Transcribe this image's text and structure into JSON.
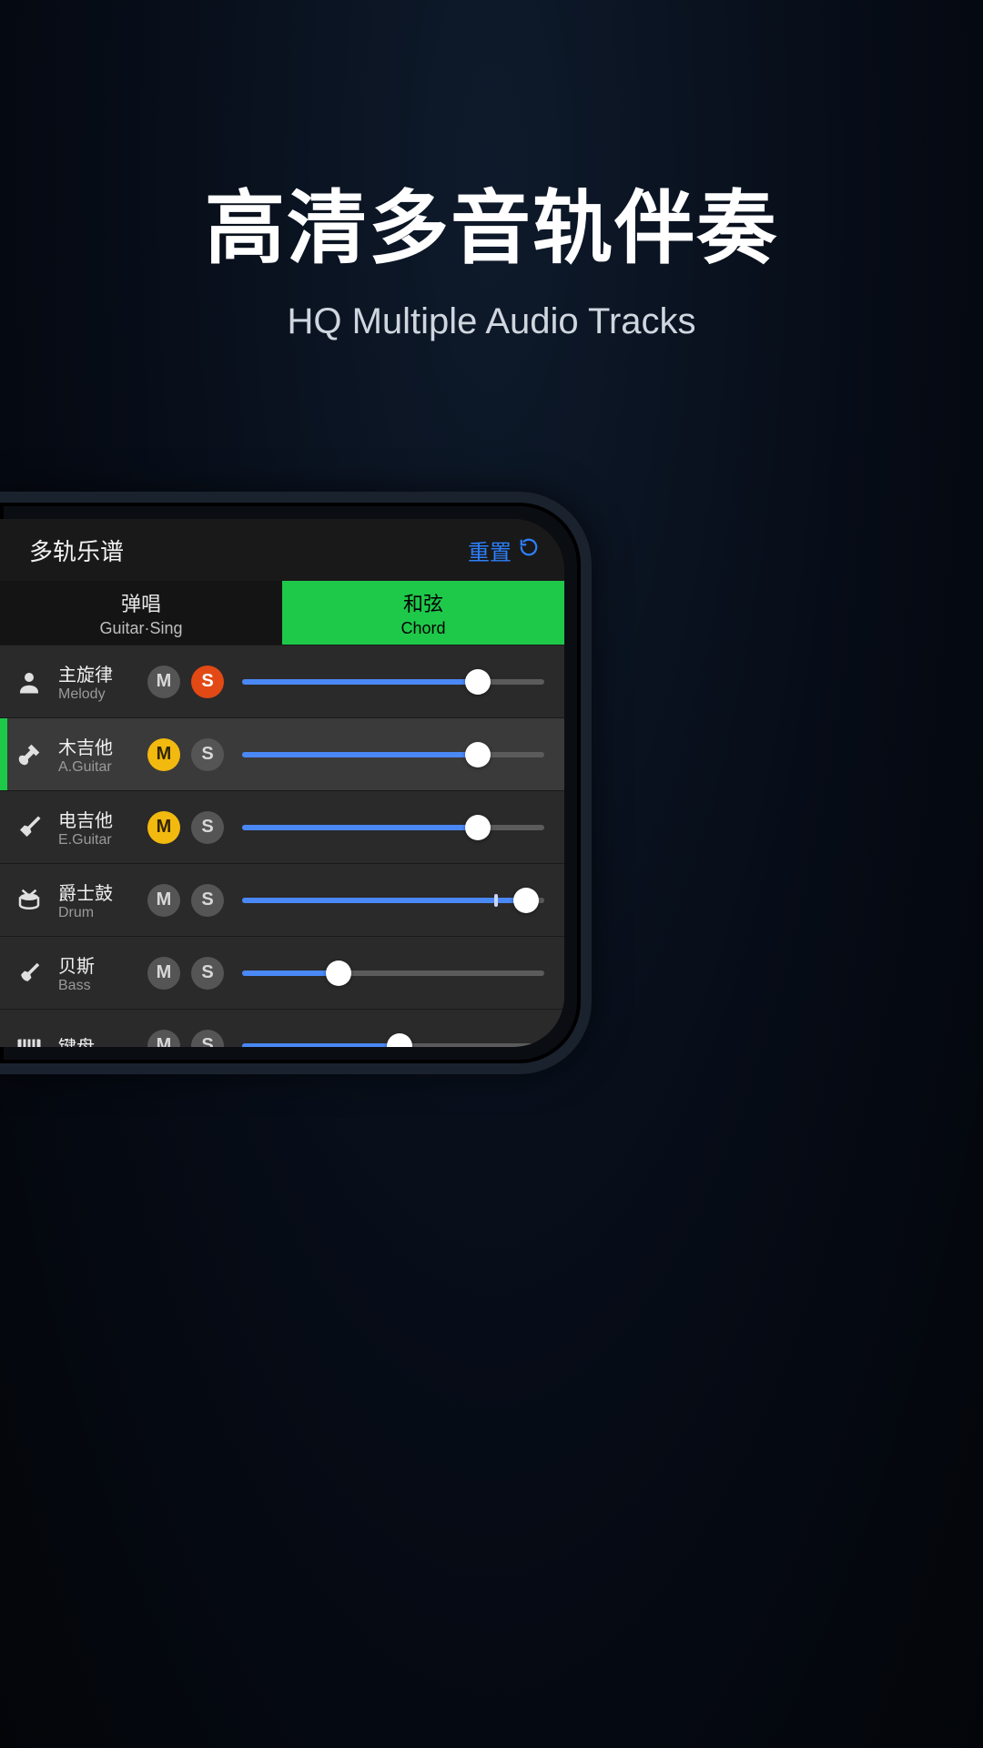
{
  "hero": {
    "title_cn": "高清多音轨伴奏",
    "title_en": "HQ Multiple Audio Tracks"
  },
  "topbar": {
    "title": "多轨乐谱",
    "reset_label": "重置"
  },
  "tabs": [
    {
      "cn": "弹唱",
      "en": "Guitar·Sing",
      "active": false
    },
    {
      "cn": "和弦",
      "en": "Chord",
      "active": true
    }
  ],
  "tracks": [
    {
      "icon": "person-icon",
      "cn": "主旋律",
      "en": "Melody",
      "m": "off",
      "s": "on",
      "value": 78,
      "tick": null,
      "selected": false
    },
    {
      "icon": "guitar-icon",
      "cn": "木吉他",
      "en": "A.Guitar",
      "m": "on",
      "s": "off",
      "value": 78,
      "tick": null,
      "selected": true
    },
    {
      "icon": "eguitar-icon",
      "cn": "电吉他",
      "en": "E.Guitar",
      "m": "on",
      "s": "off",
      "value": 78,
      "tick": null,
      "selected": false
    },
    {
      "icon": "drum-icon",
      "cn": "爵士鼓",
      "en": "Drum",
      "m": "off",
      "s": "off",
      "value": 94,
      "tick": 84,
      "selected": false
    },
    {
      "icon": "bass-icon",
      "cn": "贝斯",
      "en": "Bass",
      "m": "off",
      "s": "off",
      "value": 32,
      "tick": null,
      "selected": false
    },
    {
      "icon": "piano-icon",
      "cn": "键盘",
      "en": "",
      "m": "off",
      "s": "off",
      "value": 52,
      "tick": null,
      "selected": false
    }
  ],
  "colors": {
    "accent_green": "#1ec94a",
    "accent_blue": "#2d7ff9",
    "mute_yellow": "#f2b90f",
    "solo_orange": "#e24914",
    "slider_blue": "#4a88f5"
  }
}
